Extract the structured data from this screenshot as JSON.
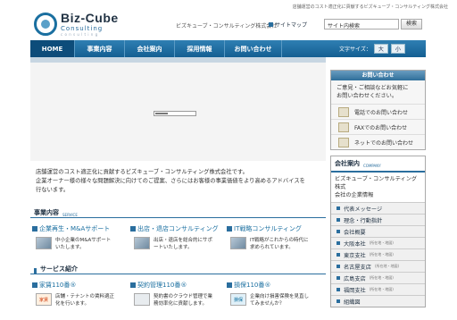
{
  "header": {
    "tagline": "店舗運営のコスト適正化に貢献するビズキューブ・コンサルティング株式会社",
    "logo_line1": "Biz-Cube",
    "logo_line2": "Consulting",
    "logo_line3": "c o n s u l t i n g",
    "company": "ビズキューブ・コンサルティング株式会社",
    "sitemap": "サイトマップ",
    "search_value": "サイト内検索",
    "search_button": "検索"
  },
  "nav": {
    "items": [
      "HOME",
      "事業内容",
      "会社案内",
      "採用情報",
      "お問い合わせ"
    ],
    "font_label": "文字サイズ：",
    "font_large": "大",
    "font_small": "小"
  },
  "intro": {
    "line1": "店舗運営のコスト適正化に貢献するビズキューブ・コンサルティング株式会社です。",
    "line2": "企業オーナー様の様々な問題解決に向けてのご提案、さらにはお客様の事業価値をより高めるアドバイスを",
    "line3": "行ないます。"
  },
  "business": {
    "title": "事業内容",
    "en": "SERVICE",
    "cards": [
      {
        "title": "企業再生・M&Aサポート",
        "text1": "中小企業のM&Aサポート",
        "text2": "いたします。"
      },
      {
        "title": "出店・退店コンサルティング",
        "text1": "出店・退店を総合的にサポ",
        "text2": "ートいたします。"
      },
      {
        "title": "IT戦略コンサルティング",
        "text1": "IT戦略がこれからの時代に",
        "text2": "求められています。"
      }
    ]
  },
  "services": {
    "title": "サービス紹介",
    "cards": [
      {
        "title": "家賃110番®",
        "text1": "店舗・テナントの賃料適正",
        "text2": "化を行います。",
        "thumb": "家賃"
      },
      {
        "title": "契約管理110番®",
        "text1": "契約書のクラウド管理で業",
        "text2": "務効率化に貢献します。",
        "thumb": ""
      },
      {
        "title": "損保110番®",
        "text1": "企業向け損害保険を見直し",
        "text2": "てみませんか？",
        "thumb": "損保"
      }
    ]
  },
  "inquiry": {
    "title": "お問い合わせ",
    "text1": "ご意見・ご相談などお気軽に",
    "text2": "お問い合わせください。",
    "rows": [
      "電話でのお問い合わせ",
      "FAXでのお問い合わせ",
      "ネットでのお問い合わせ"
    ]
  },
  "company_info": {
    "title": "会社案内",
    "en": "COMPANY",
    "desc1": "ビズキューブ・コンサルティング株式",
    "desc2": "会社の企業情報",
    "items": [
      {
        "label": "代表メッセージ",
        "sub": ""
      },
      {
        "label": "理念・行動指針",
        "sub": ""
      },
      {
        "label": "会社概要",
        "sub": ""
      },
      {
        "label": "大阪本社",
        "sub": "(所在地・地図)"
      },
      {
        "label": "東京支社",
        "sub": "(所在地・地図)"
      },
      {
        "label": "名古屋支店",
        "sub": "(所在地・地図)"
      },
      {
        "label": "広島支店",
        "sub": "(所在地・地図)"
      },
      {
        "label": "福岡支社",
        "sub": "(所在地・地図)"
      },
      {
        "label": "組織図",
        "sub": ""
      }
    ]
  }
}
